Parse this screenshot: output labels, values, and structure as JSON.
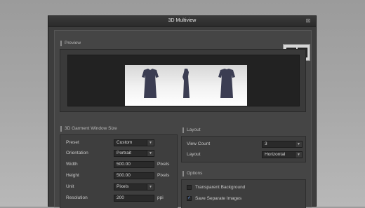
{
  "window": {
    "title": "3D Multiview",
    "close_label": "⊠"
  },
  "preview": {
    "section_title": "Preview"
  },
  "garment_size": {
    "section_title": "3D Garment Window Size",
    "rows": [
      {
        "label": "Preset",
        "value": "Custom",
        "kind": "dropdown",
        "unit": ""
      },
      {
        "label": "Orientation",
        "value": "Portrait",
        "kind": "dropdown",
        "unit": ""
      },
      {
        "label": "Width",
        "value": "500.00",
        "kind": "input",
        "unit": "Pixels"
      },
      {
        "label": "Height",
        "value": "500.00",
        "kind": "input",
        "unit": "Pixels"
      },
      {
        "label": "Unit",
        "value": "Pixels",
        "kind": "dropdown",
        "unit": ""
      },
      {
        "label": "Resolution",
        "value": "200",
        "kind": "input",
        "unit": "ppi"
      }
    ]
  },
  "layout": {
    "section_title": "Layout",
    "view_count_label": "View Count",
    "view_count_value": "3",
    "layout_label": "Layout",
    "layout_value": "Horizontal"
  },
  "options": {
    "section_title": "Options",
    "transparent_bg_label": "Transparent Background",
    "transparent_bg_checked": false,
    "save_separate_label": "Save Separate Images",
    "save_separate_checked": true
  }
}
